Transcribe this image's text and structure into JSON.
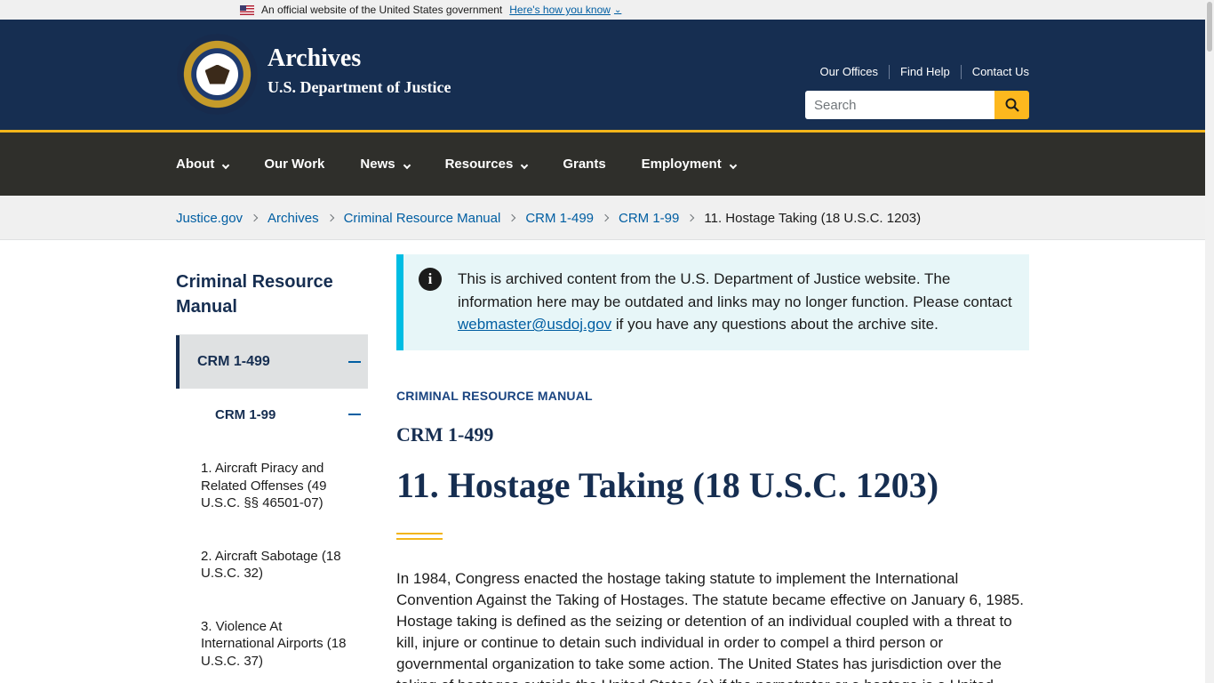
{
  "gov_banner": {
    "text": "An official website of the United States government",
    "link": "Here's how you know"
  },
  "header": {
    "title": "Archives",
    "subtitle": "U.S. Department of Justice",
    "utility_links": [
      "Our Offices",
      "Find Help",
      "Contact Us"
    ],
    "search_placeholder": "Search"
  },
  "nav": {
    "items": [
      {
        "label": "About",
        "dropdown": true
      },
      {
        "label": "Our Work",
        "dropdown": false
      },
      {
        "label": "News",
        "dropdown": true
      },
      {
        "label": "Resources",
        "dropdown": true
      },
      {
        "label": "Grants",
        "dropdown": false
      },
      {
        "label": "Employment",
        "dropdown": true
      }
    ]
  },
  "breadcrumb": {
    "links": [
      "Justice.gov",
      "Archives",
      "Criminal Resource Manual",
      "CRM 1-499",
      "CRM 1-99"
    ],
    "current": "11. Hostage Taking (18 U.S.C. 1203)"
  },
  "sidebar": {
    "title": "Criminal Resource Manual",
    "level1": "CRM 1-499",
    "level2": "CRM 1-99",
    "items": [
      "1. Aircraft Piracy and Related Offenses (49 U.S.C. §§ 46501-07)",
      "2. Aircraft Sabotage (18 U.S.C. 32)",
      "3. Violence At International Airports (18 U.S.C. 37)"
    ]
  },
  "alert": {
    "text_before": "This is archived content from the U.S. Department of Justice website. The information here may be outdated and links may no longer function. Please contact ",
    "email": "webmaster@usdoj.gov",
    "text_after": " if you have any questions about the archive site."
  },
  "main": {
    "kicker": "Criminal Resource Manual",
    "subheading": "CRM 1-499",
    "title": "11. Hostage Taking (18 U.S.C. 1203)",
    "body": "In 1984, Congress enacted the hostage taking statute to implement the International Convention Against the Taking of Hostages. The statute became effective on January 6, 1985. Hostage taking is defined as the seizing or detention of an individual coupled with a threat to kill, injure or continue to detain such individual in order to compel a third person or governmental organization to take some action. The United States has jurisdiction over the taking of hostages outside the United States (a) if the perpetrator or a hostage is a United"
  },
  "colors": {
    "header_bg": "#162e51",
    "nav_bg": "#2f2f2b",
    "accent_gold": "#f2b51a",
    "link_blue": "#005ea2",
    "alert_bg": "#e7f6f8",
    "alert_border": "#00bde3"
  }
}
